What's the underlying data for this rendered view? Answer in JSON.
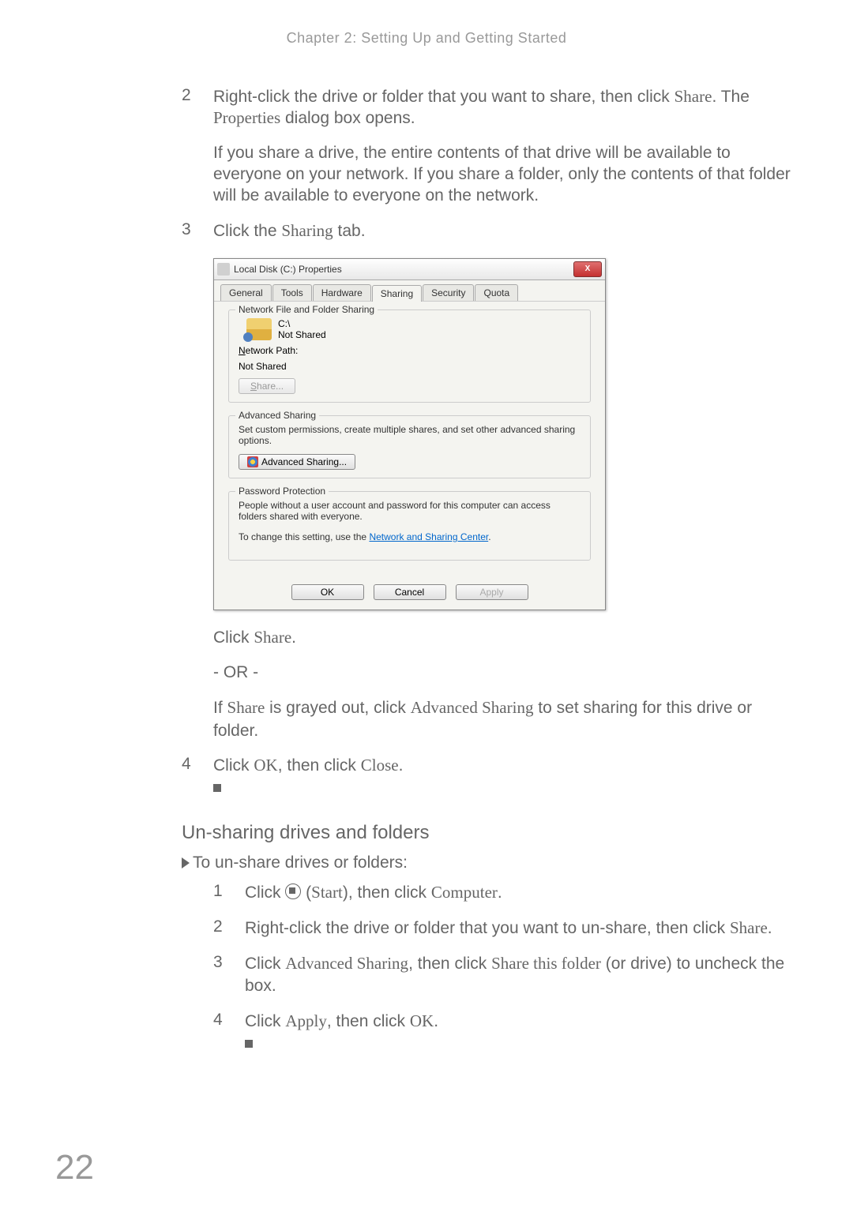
{
  "chapter_title": "Chapter 2: Setting Up and Getting Started",
  "step2": {
    "num": "2",
    "text_pre": "Right-click the drive or folder that you want to share, then click ",
    "share": "Share",
    "text_mid": ". The ",
    "properties": "Properties",
    "text_post": " dialog box opens.",
    "para2": "If you share a drive, the entire contents of that drive will be available to everyone on your network. If you share a folder, only the contents of that folder will be available to everyone on the network."
  },
  "step3": {
    "num": "3",
    "text_pre": "Click the ",
    "sharing": "Sharing",
    "text_post": " tab."
  },
  "dialog": {
    "title": "Local Disk (C:) Properties",
    "close": "X",
    "tabs": {
      "general": "General",
      "tools": "Tools",
      "hardware": "Hardware",
      "sharing": "Sharing",
      "security": "Security",
      "quota": "Quota"
    },
    "nffs": {
      "legend": "Network File and Folder Sharing",
      "drive": "C:\\",
      "status": "Not Shared",
      "netpath_label": "Network Path:",
      "netpath_value": "Not Shared",
      "share_btn": "Share..."
    },
    "adv": {
      "legend": "Advanced Sharing",
      "desc": "Set custom permissions, create multiple shares, and set other advanced sharing options.",
      "btn": "Advanced Sharing..."
    },
    "pw": {
      "legend": "Password Protection",
      "desc": "People without a user account and password for this computer can access folders shared with everyone.",
      "desc2_pre": "To change this setting, use the ",
      "link": "Network and Sharing Center",
      "desc2_post": "."
    },
    "footer": {
      "ok": "OK",
      "cancel": "Cancel",
      "apply": "Apply"
    }
  },
  "below": {
    "click_pre": "Click ",
    "share": "Share",
    "click_post": ".",
    "or": "- OR -",
    "if_pre": "If ",
    "if_share": "Share",
    "if_mid": " is grayed out, click ",
    "if_adv": "Advanced Sharing",
    "if_post": " to set sharing for this drive or folder."
  },
  "step4": {
    "num": "4",
    "text_pre": "Click ",
    "ok": "OK",
    "text_mid": ", then click ",
    "close": "Close",
    "text_post": "."
  },
  "section2": {
    "title": "Un-sharing drives and folders",
    "proc": "To un-share drives or folders:",
    "s1": {
      "num": "1",
      "pre": "Click ",
      "start": "Start",
      "mid": "), then click ",
      "computer": "Computer",
      "post": "."
    },
    "s2": {
      "num": "2",
      "pre": "Right-click the drive or folder that you want to un-share, then click ",
      "share": "Share",
      "post": "."
    },
    "s3": {
      "num": "3",
      "pre": "Click ",
      "adv": "Advanced Sharing",
      "mid": ", then click ",
      "stf": "Share this folder",
      "post": " (or drive) to uncheck the box."
    },
    "s4": {
      "num": "4",
      "pre": "Click ",
      "apply": "Apply",
      "mid": ", then click ",
      "ok": "OK",
      "post": "."
    }
  },
  "page_number": "22"
}
